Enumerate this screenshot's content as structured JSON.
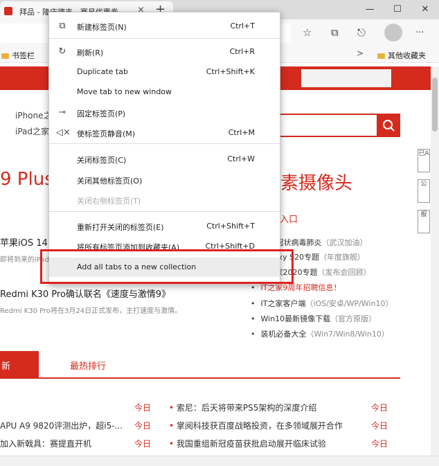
{
  "browser": {
    "tab_title": "拜品 - 隆庆德丰 - 赛易优惠券...",
    "tab_close": "×",
    "new_tab": "+",
    "win_minimize": "—",
    "win_maximize": "☐",
    "win_close": "✕",
    "more": "···",
    "fav_left": "书签栏",
    "fav_chevron": ">",
    "fav_right": "其他收藏夹"
  },
  "page": {
    "top_links": [
      "iPhone之家",
      "iPad之家"
    ],
    "headline_left": "9 Plus",
    "headline_right": "素摄像头",
    "entry_label": "入口",
    "story1_title": "苹果iOS 14",
    "story1_sub": "即将到来的iPad",
    "story2_title": "Redmi K30 Pro确认联名《速度与激情9》",
    "story2_sub": "Redmi K30 Pro将在3月24日正式发布，主打速度与激情。",
    "right_list": [
      {
        "text": "新型冠状病毒肺炎",
        "gray": "（武汉加油）",
        "red": false
      },
      {
        "text": "Galaxy S20专题",
        "gray": "（年度旗舰）",
        "red": false
      },
      {
        "text": "IT之家2020专题",
        "gray": "（发布会回顾）",
        "red": false
      },
      {
        "text": "IT之家9周年招聘信息！",
        "gray": "",
        "red": true
      },
      {
        "text": "IT之家客户端",
        "gray": "（iOS/安卓/WP/Win10）",
        "red": false
      },
      {
        "text": "Win10最新镜像下载",
        "gray": "（官方原版）",
        "red": false
      },
      {
        "text": "装机必备大全",
        "gray": "（Win7/Win8/Win10）",
        "red": false
      }
    ],
    "tab_new": "新",
    "tab_hot": "最热排行",
    "news_left": [
      {
        "text": "",
        "date": "今日"
      },
      {
        "text": "APU A9 9820评测出炉，超i5-...",
        "date": "今日"
      },
      {
        "text": "加入新戟具：赛提直开机",
        "date": "今日"
      }
    ],
    "news_right": [
      {
        "text": "索尼：后天将带来PS5架构的深度介绍",
        "date": "今日"
      },
      {
        "text": "掌阅科技获百度战略投资，在多领域展开合作",
        "date": "今日"
      },
      {
        "text": "我国重组新冠疫苗获批启动展开临床试验",
        "date": "今日"
      }
    ],
    "side_boxes": [
      "已A",
      "公",
      "报"
    ]
  },
  "context_menu": {
    "items": [
      {
        "icon": "⧉",
        "label": "新建标签页(N)",
        "shortcut": "Ctrl+T",
        "disabled": false
      },
      {
        "icon": "↻",
        "label": "刷新(R)",
        "shortcut": "Ctrl+R",
        "disabled": false
      },
      {
        "icon": "",
        "label": "Duplicate tab",
        "shortcut": "Ctrl+Shift+K",
        "disabled": false
      },
      {
        "icon": "",
        "label": "Move tab to new window",
        "shortcut": "",
        "disabled": false
      },
      {
        "icon": "⊸",
        "label": "固定标签页(P)",
        "shortcut": "",
        "disabled": false
      },
      {
        "icon": "◁×",
        "label": "使标签页静音(M)",
        "shortcut": "Ctrl+M",
        "disabled": false
      },
      {
        "icon": "",
        "label": "关闭标签页(C)",
        "shortcut": "Ctrl+W",
        "disabled": false
      },
      {
        "icon": "",
        "label": "关闭其他标签页(O)",
        "shortcut": "",
        "disabled": false
      },
      {
        "icon": "",
        "label": "关闭右侧标签页(T)",
        "shortcut": "",
        "disabled": true
      },
      {
        "icon": "",
        "label": "重新打开关闭的标签页(E)",
        "shortcut": "Ctrl+Shift+T",
        "disabled": false
      },
      {
        "icon": "",
        "label": "将所有标签页添加到收藏夹(A)",
        "shortcut": "Ctrl+Shift+D",
        "disabled": false
      },
      {
        "icon": "",
        "label": "Add all tabs to a new collection",
        "shortcut": "",
        "disabled": false
      }
    ]
  },
  "colors": {
    "accent": "#d42b1e",
    "highlight": "#e02020"
  }
}
